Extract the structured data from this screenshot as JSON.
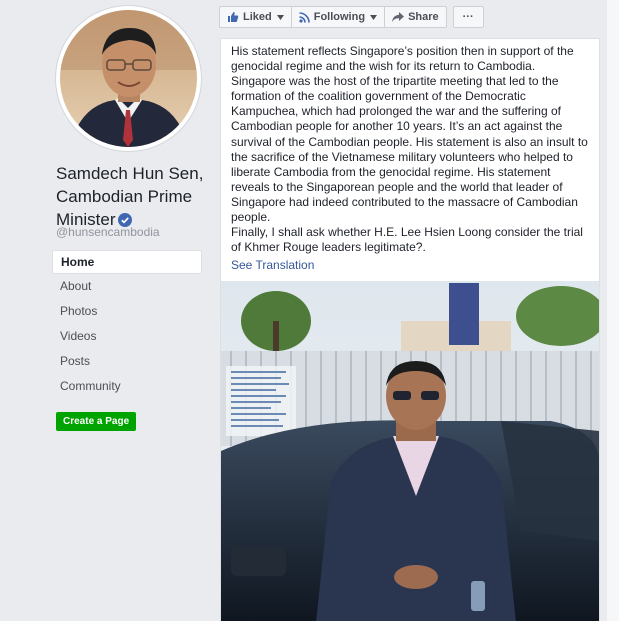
{
  "profile": {
    "name": "Samdech Hun Sen, Cambodian Prime Minister",
    "handle": "@hunsencambodia",
    "verified_icon": "verified-badge-icon"
  },
  "nav": {
    "items": [
      {
        "label": "Home",
        "active": true
      },
      {
        "label": "About"
      },
      {
        "label": "Photos"
      },
      {
        "label": "Videos"
      },
      {
        "label": "Posts"
      },
      {
        "label": "Community"
      }
    ],
    "create_page": "Create a Page"
  },
  "actions": {
    "liked": "Liked",
    "following": "Following",
    "share": "Share",
    "more": "···"
  },
  "post": {
    "text": "His statement reflects Singapore’s position then in support of the genocidal regime and the wish for its return to Cambodia. Singapore was the host of the tripartite meeting that led to the formation of the coalition government of the Democratic Kampuchea, which had prolonged the war and the suffering of Cambodian people for another 10 years. It’s an act against the survival of the Cambodian people. His statement is also an insult to the sacrifice of the Vietnamese military volunteers who helped to liberate Cambodia from the genocidal regime. His statement reveals to the Singaporean people and the world that leader of Singapore had indeed contributed to the massacre of Cambodian people.\nFinally, I shall ask whether H.E. Lee Hsien Loong consider the trial of Khmer Rouge leaders legitimate?.",
    "see_translation": "See Translation"
  },
  "colors": {
    "link": "#365899",
    "green_button": "#00a400",
    "background": "#e9ebee"
  }
}
